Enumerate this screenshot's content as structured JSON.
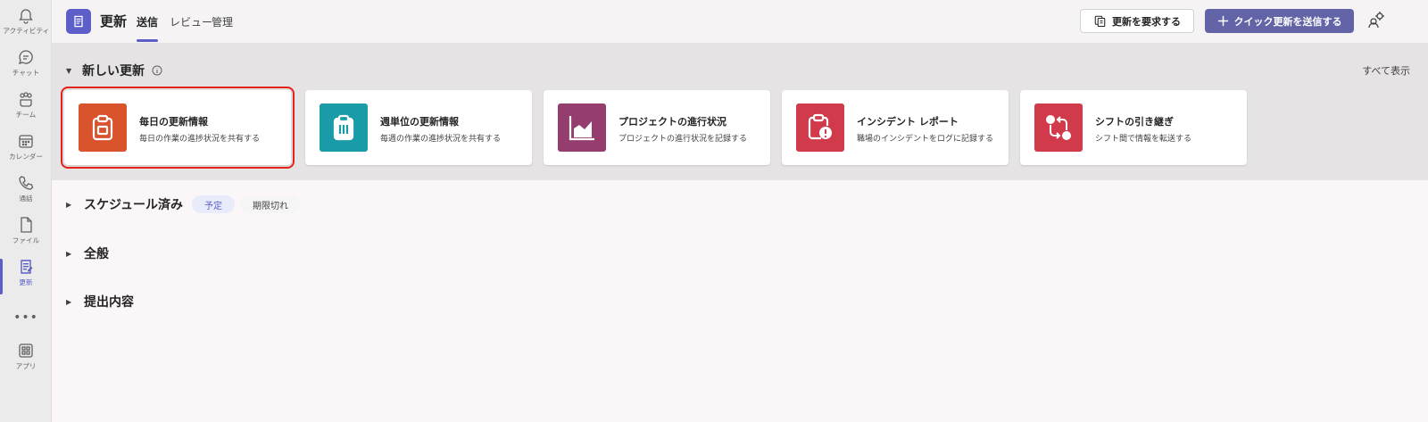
{
  "rail": {
    "items": [
      {
        "label": "アクティビティ",
        "icon": "bell-icon"
      },
      {
        "label": "チャット",
        "icon": "chat-icon"
      },
      {
        "label": "チーム",
        "icon": "teams-icon"
      },
      {
        "label": "カレンダー",
        "icon": "calendar-icon"
      },
      {
        "label": "通話",
        "icon": "phone-icon"
      },
      {
        "label": "ファイル",
        "icon": "file-icon"
      },
      {
        "label": "更新",
        "icon": "updates-icon"
      },
      {
        "label": "アプリ",
        "icon": "apps-icon"
      }
    ],
    "more": "•••",
    "active_color": "#5b5fc7"
  },
  "header": {
    "title": "更新",
    "tabs": [
      {
        "label": "送信",
        "active": true
      },
      {
        "label": "レビュー",
        "active": false
      },
      {
        "label": "管理",
        "active": false
      }
    ],
    "request_button": "更新を要求する",
    "primary_button": "クイック更新を送信する",
    "primary_color": "#6264a7"
  },
  "new_updates": {
    "title": "新しい更新",
    "see_all": "すべて表示",
    "cards": [
      {
        "title": "毎日の更新情報",
        "subtitle": "毎日の作業の進捗状況を共有する",
        "color": "#d9532c",
        "icon": "clipboard-icon"
      },
      {
        "title": "週単位の更新情報",
        "subtitle": "毎週の作業の進捗状況を共有する",
        "color": "#1a9ca8",
        "icon": "clipboard-list-icon"
      },
      {
        "title": "プロジェクトの進行状況",
        "subtitle": "プロジェクトの進行状況を記録する",
        "color": "#943d6e",
        "icon": "area-chart-icon"
      },
      {
        "title": "インシデント レポート",
        "subtitle": "職場のインシデントをログに記録する",
        "color": "#d13a4a",
        "icon": "clipboard-alert-icon"
      },
      {
        "title": "シフトの引き継ぎ",
        "subtitle": "シフト間で情報を転送する",
        "color": "#d13a4a",
        "icon": "shift-swap-icon"
      }
    ]
  },
  "sections": {
    "scheduled": {
      "title": "スケジュール済み",
      "pills": [
        "予定",
        "期限切れ"
      ]
    },
    "general": {
      "title": "全般"
    },
    "submissions": {
      "title": "提出内容"
    }
  }
}
